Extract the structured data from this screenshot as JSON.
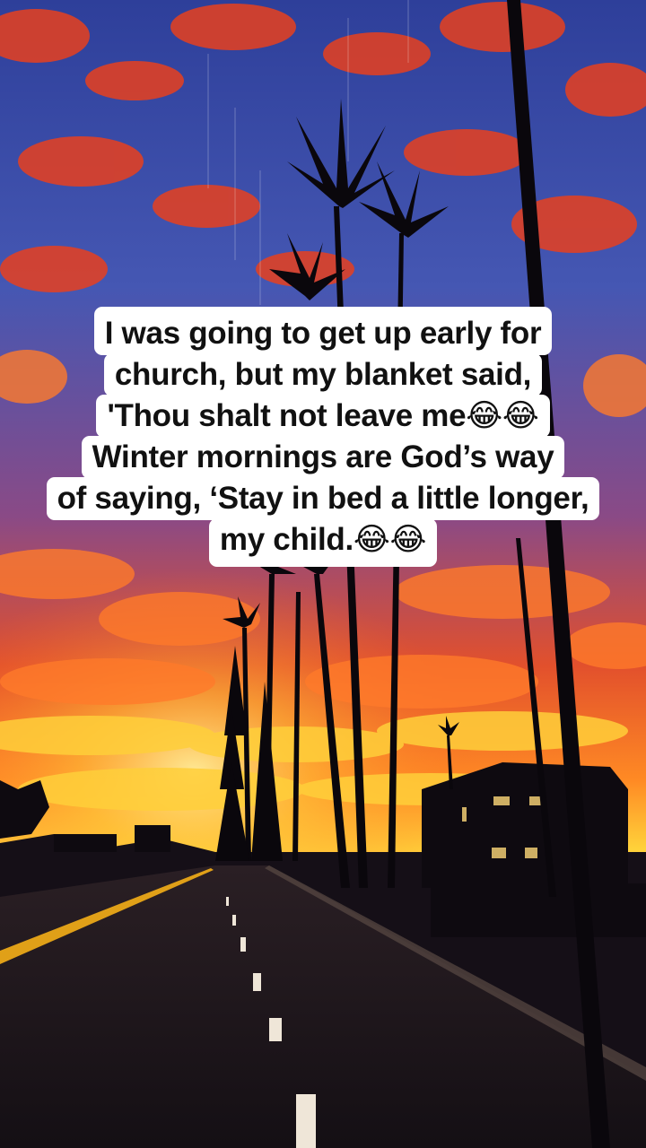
{
  "overlay_caption": {
    "lines": [
      "I was going to get up early for",
      "church, but my blanket said,",
      "'Thou shalt not leave me😂😂",
      "Winter mornings are God’s way",
      "of saying, ‘Stay in bed a little longer,",
      "my child.😂😂"
    ]
  },
  "colors": {
    "caption_background": "#ffffff",
    "caption_text": "#111111",
    "sky_blue": "#3a4fa8",
    "cloud_red": "#e8401e",
    "horizon_gold": "#ffd23a",
    "road_dark": "#1a1418"
  }
}
